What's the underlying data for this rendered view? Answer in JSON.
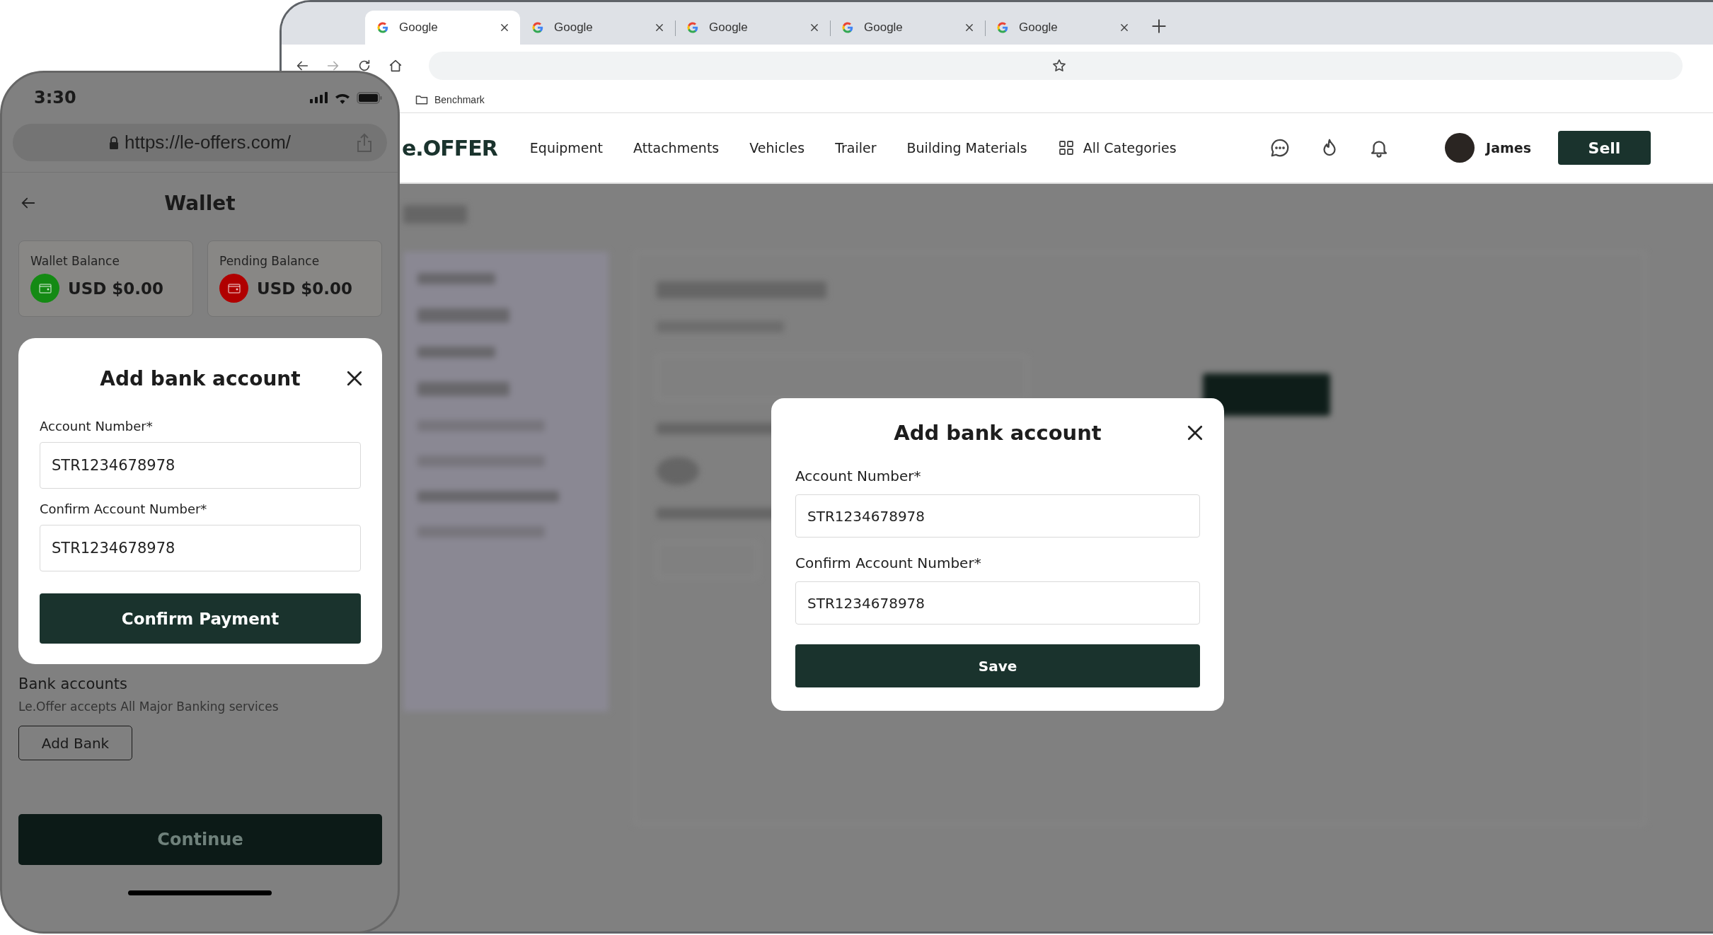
{
  "browser": {
    "tabs": [
      {
        "title": "Google",
        "selected": true
      },
      {
        "title": "Google",
        "selected": false
      },
      {
        "title": "Google",
        "selected": false
      },
      {
        "title": "Google",
        "selected": false
      },
      {
        "title": "Google",
        "selected": false
      }
    ],
    "bookmarks": [
      {
        "label": "Benchmark"
      }
    ]
  },
  "site_nav": {
    "logo": "e.OFFER",
    "links": [
      "Equipment",
      "Attachments",
      "Vehicles",
      "Trailer",
      "Building Materials"
    ],
    "all_categories": "All Categories",
    "user_name": "James",
    "sell_button": "Sell"
  },
  "desktop_modal": {
    "title": "Add bank account",
    "fields": [
      {
        "label": "Account Number*",
        "value": "STR1234678978"
      },
      {
        "label": "Confirm Account Number*",
        "value": "STR1234678978"
      }
    ],
    "submit": "Save"
  },
  "phone": {
    "time": "3:30",
    "url": "https://le-offers.com/",
    "page_title": "Wallet",
    "balances": [
      {
        "label": "Wallet Balance",
        "amount": "USD $0.00",
        "color": "#148a14"
      },
      {
        "label": "Pending Balance",
        "amount": "USD $0.00",
        "color": "#b00000"
      }
    ],
    "modal": {
      "title": "Add bank account",
      "fields": [
        {
          "label": "Account Number*",
          "value": "STR1234678978"
        },
        {
          "label": "Confirm Account Number*",
          "value": "STR1234678978"
        }
      ],
      "submit": "Confirm Payment"
    },
    "bank_accounts": {
      "title": "Bank accounts",
      "subtitle": "Le.Offer accepts All Major Banking services",
      "add_button": "Add Bank"
    },
    "continue_button": "Continue"
  }
}
